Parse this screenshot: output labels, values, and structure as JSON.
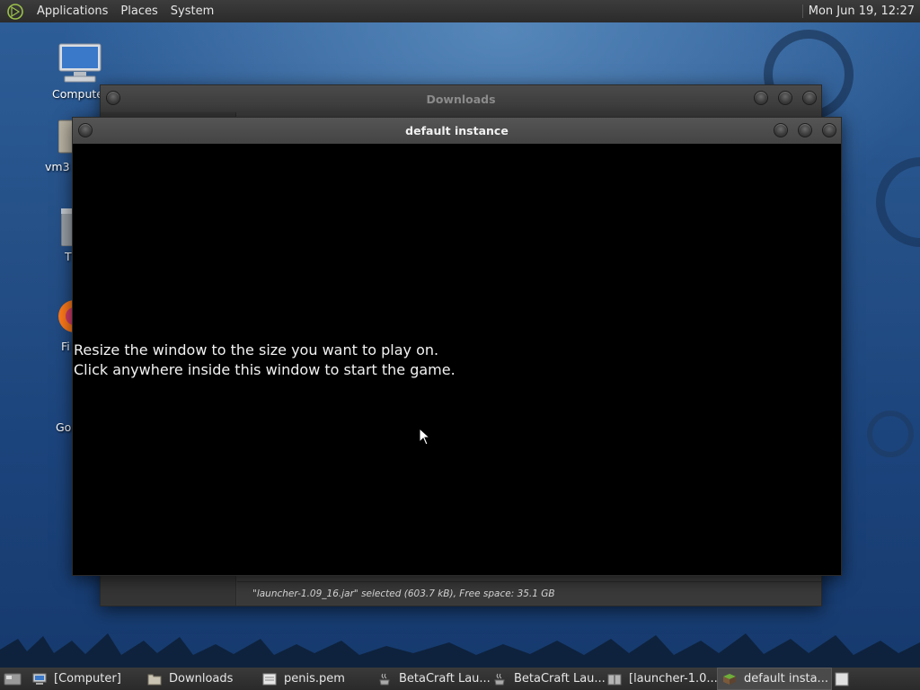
{
  "top_panel": {
    "menus": [
      "Applications",
      "Places",
      "System"
    ],
    "clock": "Mon Jun 19, 12:27"
  },
  "desktop_icons": [
    {
      "label": "Compute",
      "icon": "computer-icon"
    },
    {
      "label": "vm3",
      "icon": "home-folder-icon"
    },
    {
      "label": "T",
      "icon": "trash-icon"
    },
    {
      "label": "Fi",
      "icon": "firefox-icon"
    },
    {
      "label": "Go",
      "icon": "app-icon"
    }
  ],
  "downloads_window": {
    "title": "Downloads",
    "status": "\"launcher-1.09_16.jar\" selected (603.7 kB), Free space: 35.1 GB"
  },
  "game_window": {
    "title": "default instance",
    "message_line1": "Resize the window to the size you want to play on.",
    "message_line2": "Click anywhere inside this window to start the game."
  },
  "taskbar": {
    "items": [
      {
        "label": "[Computer]",
        "icon": "computer-icon",
        "active": false
      },
      {
        "label": "Downloads",
        "icon": "folder-icon",
        "active": false
      },
      {
        "label": "penis.pem",
        "icon": "text-file-icon",
        "active": false
      },
      {
        "label": "BetaCraft Lau...",
        "icon": "java-icon",
        "active": false
      },
      {
        "label": "BetaCraft Lau...",
        "icon": "java-icon",
        "active": false
      },
      {
        "label": "[launcher-1.0...",
        "icon": "archive-icon",
        "active": false
      },
      {
        "label": "default insta...",
        "icon": "grass-block-icon",
        "active": true
      }
    ]
  },
  "colors": {
    "panel": "#2f2f2f",
    "wallpaper": "#244f86",
    "game_bg": "#000000"
  }
}
